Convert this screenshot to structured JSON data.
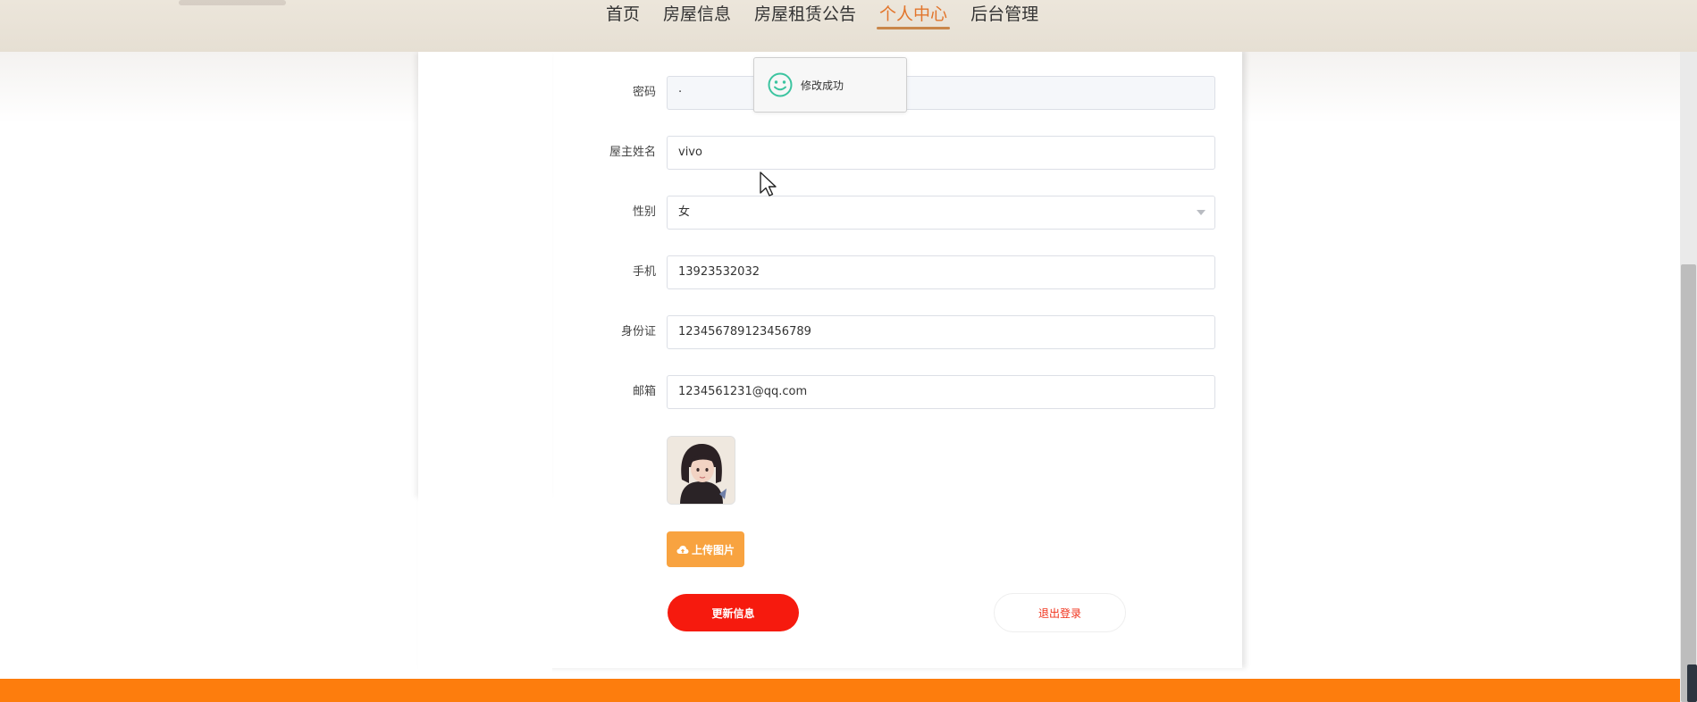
{
  "nav": {
    "items": [
      {
        "label": "首页",
        "active": false
      },
      {
        "label": "房屋信息",
        "active": false
      },
      {
        "label": "房屋租赁公告",
        "active": false
      },
      {
        "label": "个人中心",
        "active": true
      },
      {
        "label": "后台管理",
        "active": false
      }
    ]
  },
  "form": {
    "password": {
      "label": "密码",
      "value": "·"
    },
    "name": {
      "label": "屋主姓名",
      "value": "vivo"
    },
    "gender": {
      "label": "性别",
      "value": "女"
    },
    "phone": {
      "label": "手机",
      "value": "13923532032"
    },
    "idcard": {
      "label": "身份证",
      "value": "123456789123456789"
    },
    "email": {
      "label": "邮箱",
      "value": "1234561231@qq.com"
    }
  },
  "buttons": {
    "upload": "上传图片",
    "update": "更新信息",
    "logout": "退出登录"
  },
  "toast": {
    "message": "修改成功"
  },
  "colors": {
    "accent_orange": "#fd7d0d",
    "update_red": "#f61a0e",
    "upload_orange": "#f8a340",
    "nav_active": "#e2752b",
    "toast_green": "#3cc4a0"
  },
  "icons": {
    "toast": "smile-face-icon",
    "upload": "cloud-upload-icon",
    "select": "chevron-down-icon",
    "cursor": "mouse-pointer-icon"
  }
}
